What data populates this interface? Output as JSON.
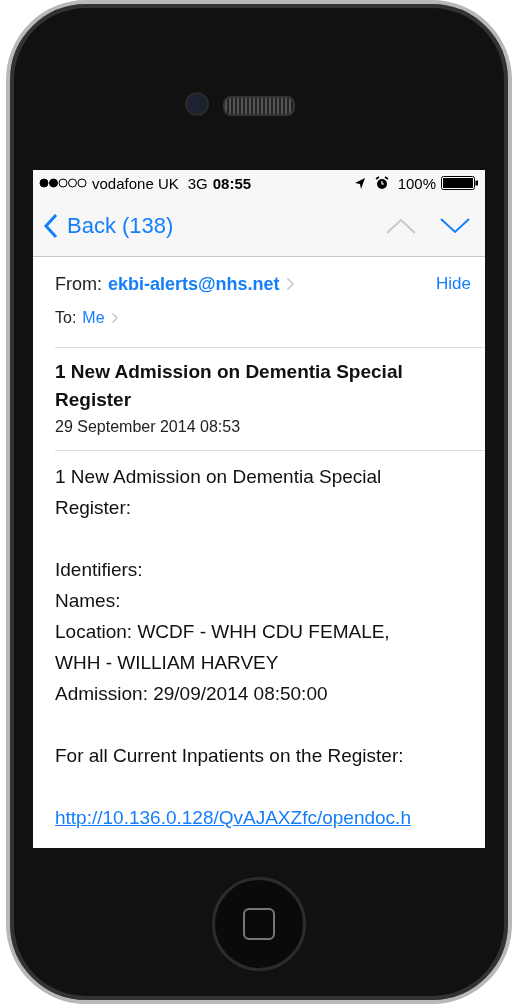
{
  "status_bar": {
    "carrier": "vodafone UK",
    "network": "3G",
    "time": "08:55",
    "battery": "100%"
  },
  "nav": {
    "back": "Back (138)",
    "previous_enabled": false,
    "next_enabled": true
  },
  "header": {
    "from_label": "From:",
    "from": "ekbi-alerts@nhs.net",
    "hide": "Hide",
    "to_label": "To:",
    "to": "Me"
  },
  "subject": "1 New Admission on Dementia Special Register",
  "date": "29 September 2014 08:53",
  "body": [
    [
      "1 New Admission on Dementia Special Register:"
    ],
    [
      "Identifiers:",
      "Names:",
      "Location: WCDF - WHH CDU FEMALE, WHH - WILLIAM HARVEY",
      "Admission: 29/09/2014 08:50:00"
    ],
    [
      "For all Current Inpatients on the Register:"
    ]
  ],
  "link": "http://10.136.0.128/QvAJAXZfc/opendoc.h"
}
